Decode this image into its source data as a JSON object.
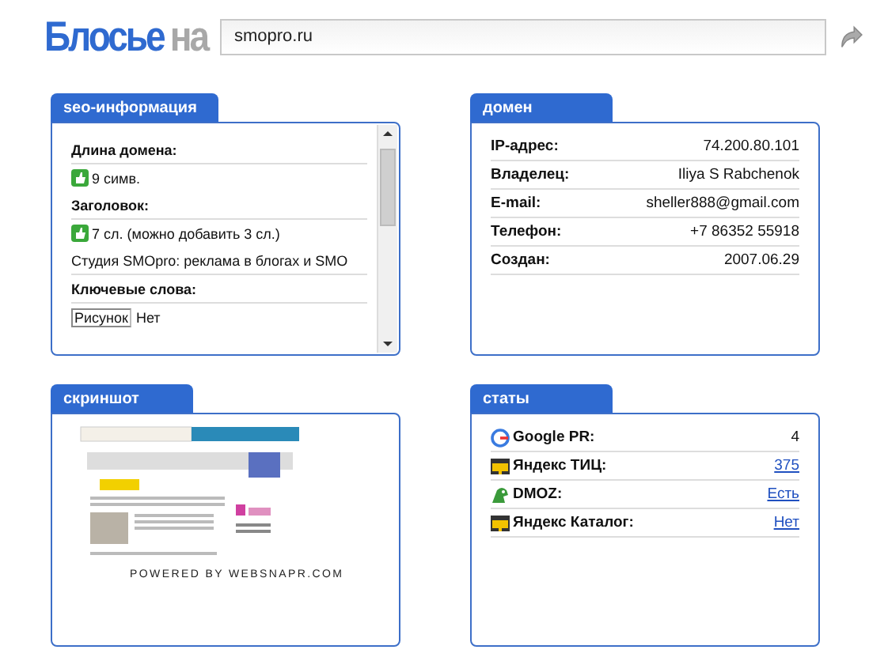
{
  "logo": {
    "main": "Блосье",
    "suffix": "на"
  },
  "search": {
    "value": "smopro.ru"
  },
  "seo": {
    "title": "seo-информация",
    "rows": [
      {
        "kind": "label",
        "text": "Длина домена:"
      },
      {
        "kind": "check",
        "text": "9 симв."
      },
      {
        "kind": "label",
        "text": "Заголовок:"
      },
      {
        "kind": "check",
        "text": "7 сл. (можно добавить 3 сл.)"
      },
      {
        "kind": "text",
        "text": "Студия SMOpro: реклама в блогах и SMO"
      },
      {
        "kind": "label",
        "text": "Ключевые слова:"
      },
      {
        "kind": "image",
        "text": "Рисунок",
        "value": "Нет"
      }
    ]
  },
  "domain": {
    "title": "домен",
    "rows": [
      {
        "label": "IP-адрес:",
        "value": "74.200.80.101"
      },
      {
        "label": "Владелец:",
        "value": "Iliya S Rabchenok"
      },
      {
        "label": "E-mail:",
        "value": "sheller888@gmail.com"
      },
      {
        "label": "Телефон:",
        "value": "+7 86352 55918"
      },
      {
        "label": "Создан:",
        "value": "2007.06.29"
      }
    ]
  },
  "screenshot": {
    "title": "скриншот",
    "caption": "POWERED BY WEBSNAPR.COM"
  },
  "stats": {
    "title": "статы",
    "rows": [
      {
        "kind": "google",
        "label": "Google PR:",
        "value": "4",
        "link": false
      },
      {
        "kind": "yandex",
        "label": "Яндекс ТИЦ:",
        "value": "375",
        "link": true
      },
      {
        "kind": "dmoz",
        "label": "DMOZ:",
        "value": "Есть",
        "link": true
      },
      {
        "kind": "yandex",
        "label": "Яндекс Каталог:",
        "value": "Нет",
        "link": true
      }
    ]
  }
}
